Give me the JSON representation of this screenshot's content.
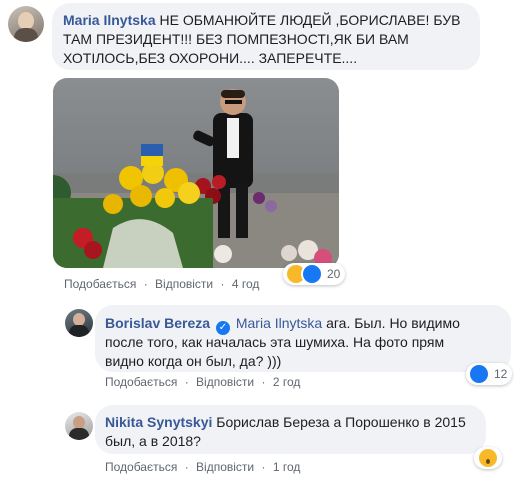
{
  "comments": [
    {
      "author": "Maria Ilnytska",
      "text_line1": "НЕ ОБМАНЮЙТЕ ЛЮДЕЙ ,БОРИСЛАВЕ! БУВ",
      "text_line2": "ТАМ ПРЕЗИДЕНТ!!! БЕЗ ПОМПЕЗНОСТІ,ЯК БИ ВАМ",
      "text_line3": "ХОТІЛОСЬ,БЕЗ ОХОРОНИ.... ЗАПЕРЕЧТЕ....",
      "actions": {
        "like": "Подобається",
        "reply": "Відповісти",
        "time": "4 год"
      },
      "reactions": {
        "count": "20",
        "icons": [
          "haha-icon",
          "like-icon"
        ]
      }
    },
    {
      "author": "Borislav Bereza",
      "verified": true,
      "mention": "Maria Ilnytska",
      "text_line1": " ага. Был. Но видимо",
      "text_line2": "после того, как началась эта шумиха. На фото прям",
      "text_line3": "видно когда он был, да? )))",
      "actions": {
        "like": "Подобається",
        "reply": "Відповісти",
        "time": "2 год"
      },
      "reactions": {
        "count": "12",
        "icons": [
          "like-icon"
        ]
      }
    },
    {
      "author": "Nikita Synytskyi",
      "text_line1": " Борислав Береза а Порошенко в 2015",
      "text_line2": "был, а в 2018?",
      "actions": {
        "like": "Подобається",
        "reply": "Відповісти",
        "time": "1 год"
      },
      "reactions": {
        "icons": [
          "wow-icon"
        ]
      }
    }
  ],
  "colors": {
    "link": "#385898",
    "bubble": "#f0f2f5",
    "meta": "#606770",
    "like": "#1877f2"
  }
}
